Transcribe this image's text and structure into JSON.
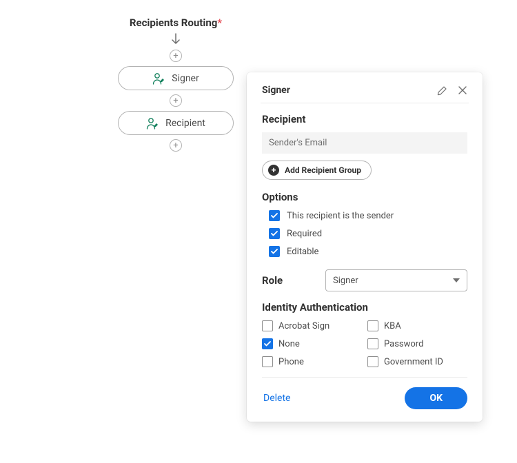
{
  "flow": {
    "title": "Recipients Routing",
    "required_mark": "*",
    "nodes": [
      {
        "label": "Signer"
      },
      {
        "label": "Recipient"
      }
    ]
  },
  "panel": {
    "title": "Signer",
    "recipient_section": "Recipient",
    "email_value": "Sender's Email",
    "add_group_label": "Add Recipient Group",
    "options_section": "Options",
    "options": [
      {
        "label": "This recipient is the sender",
        "checked": true
      },
      {
        "label": "Required",
        "checked": true
      },
      {
        "label": "Editable",
        "checked": true
      }
    ],
    "role_label": "Role",
    "role_value": "Signer",
    "auth_section": "Identity Authentication",
    "auth": [
      {
        "label": "Acrobat Sign",
        "checked": false
      },
      {
        "label": "KBA",
        "checked": false
      },
      {
        "label": "None",
        "checked": true
      },
      {
        "label": "Password",
        "checked": false
      },
      {
        "label": "Phone",
        "checked": false
      },
      {
        "label": "Government ID",
        "checked": false
      }
    ],
    "delete_label": "Delete",
    "ok_label": "OK"
  }
}
